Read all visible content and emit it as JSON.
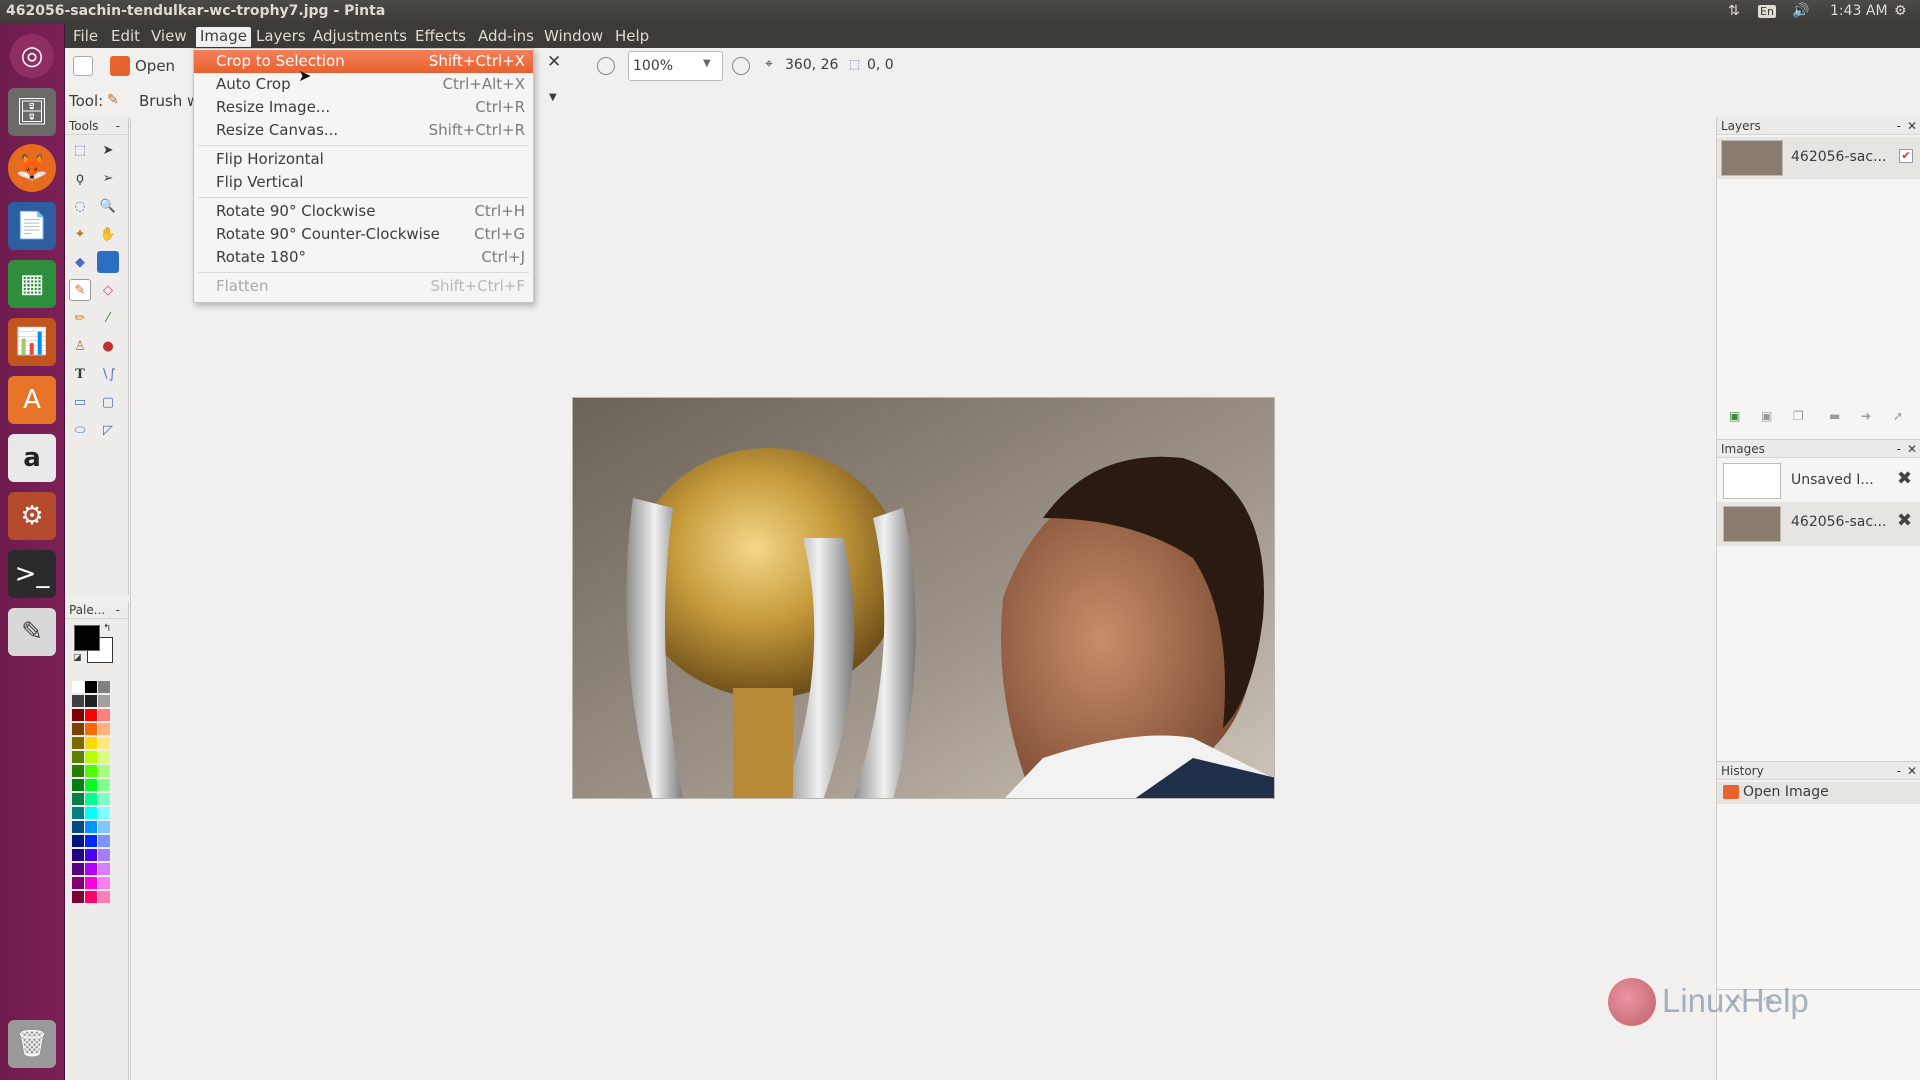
{
  "window_title": "462056-sachin-tendulkar-wc-trophy7.jpg - Pinta",
  "system": {
    "keyboard": "En",
    "clock": "1:43 AM"
  },
  "menubar": [
    "File",
    "Edit",
    "View",
    "Image",
    "Layers",
    "Adjustments",
    "Effects",
    "Add-ins",
    "Window",
    "Help"
  ],
  "toolbar": {
    "open_label": "Open",
    "zoom_value": "100%",
    "cursor_position": "360, 26",
    "selection_size": "0, 0",
    "tool_label": "Tool:",
    "brush_label": "Brush w"
  },
  "image_menu": [
    {
      "label": "Crop to Selection",
      "accel": "Shift+Ctrl+X",
      "state": "highlighted"
    },
    {
      "label": "Auto Crop",
      "accel": "Ctrl+Alt+X",
      "state": "normal"
    },
    {
      "label": "Resize Image...",
      "accel": "Ctrl+R",
      "state": "normal"
    },
    {
      "label": "Resize Canvas...",
      "accel": "Shift+Ctrl+R",
      "state": "normal"
    },
    {
      "label": "Flip Horizontal",
      "accel": "",
      "state": "normal"
    },
    {
      "label": "Flip Vertical",
      "accel": "",
      "state": "normal"
    },
    {
      "label": "Rotate 90° Clockwise",
      "accel": "Ctrl+H",
      "state": "normal"
    },
    {
      "label": "Rotate 90° Counter-Clockwise",
      "accel": "Ctrl+G",
      "state": "normal"
    },
    {
      "label": "Rotate 180°",
      "accel": "Ctrl+J",
      "state": "normal"
    },
    {
      "label": "Flatten",
      "accel": "Shift+Ctrl+F",
      "state": "disabled"
    }
  ],
  "docks": {
    "tools_title": "Tools",
    "palette_title": "Pale...",
    "layers_title": "Layers",
    "images_title": "Images",
    "history_title": "History"
  },
  "layers": [
    {
      "name": "462056-sac..."
    }
  ],
  "images": [
    {
      "name": "Unsaved I..."
    },
    {
      "name": "462056-sac..."
    }
  ],
  "history": [
    {
      "label": "Open Image"
    }
  ],
  "watermark": "LinuxHelp",
  "colors": {
    "accent": "#ec6a3c",
    "launcher": "#77204f",
    "topbar": "#3c3b37"
  }
}
